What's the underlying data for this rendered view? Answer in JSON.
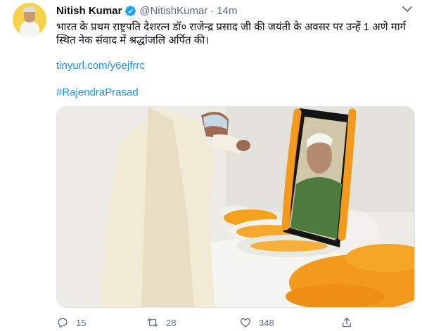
{
  "tweet": {
    "author_name": "Nitish Kumar",
    "handle": "@NitishKumar",
    "separator": "·",
    "time": "14m",
    "text": "भारत के प्रथम राष्ट्रपति देशरत्न डॉ० राजेन्द्र प्रसाद जी की जयंती के अवसर पर उन्हें 1 अणे मार्ग स्थित नेक संवाद में श्रद्धांजलि अर्पित की।",
    "link": "tinyurl.com/y6ejfrrc",
    "hashtag": "#RajendraPrasad"
  },
  "actions": {
    "reply_count": "15",
    "retweet_count": "28",
    "like_count": "348"
  },
  "icons": {
    "verified": "verified-badge-icon",
    "more": "more-options-icon",
    "reply": "reply-icon",
    "retweet": "retweet-icon",
    "like": "like-icon",
    "share": "share-icon"
  },
  "colors": {
    "link": "#1b95e0",
    "secondary_text": "#5b7083",
    "verified": "#1da1f2"
  }
}
